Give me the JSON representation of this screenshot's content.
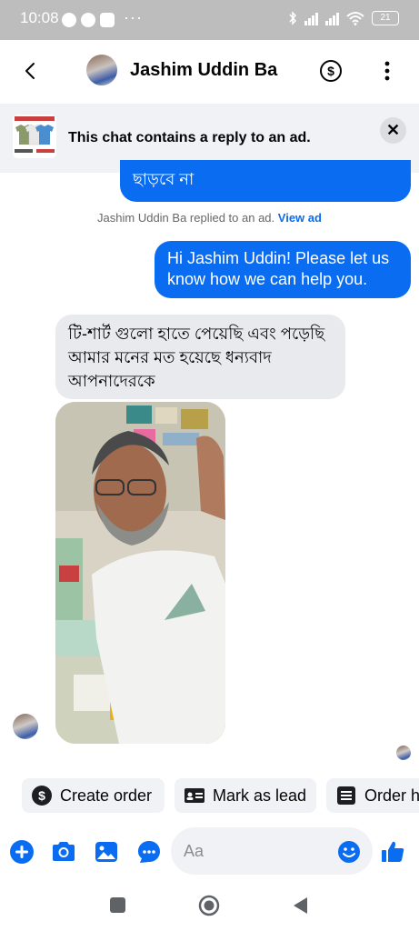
{
  "status_bar": {
    "time": "10:08",
    "overflow": "···",
    "battery": "21"
  },
  "header": {
    "contact_name": "Jashim Uddin Ba",
    "dollar_symbol": "$"
  },
  "banner": {
    "text": "This chat contains a reply to an ad.",
    "close": "✕"
  },
  "messages": {
    "top_partial": "ছাড়বে না",
    "reply_note": "Jashim Uddin Ba replied to an ad.",
    "view_ad": "View ad",
    "outgoing": "Hi Jashim Uddin! Please let us know how we can help you.",
    "incoming": "টি-শার্ট গুলো হাতে পেয়েছি এবং পড়েছি আমার মনের মত হয়েছে ধন্যবাদ আপনাদেরকে"
  },
  "quick_actions": [
    {
      "label": "Create order",
      "icon": "dollar-circle-icon"
    },
    {
      "label": "Mark as lead",
      "icon": "contact-card-icon"
    },
    {
      "label": "Order h",
      "icon": "list-doc-icon"
    }
  ],
  "composer": {
    "placeholder": "Aa"
  },
  "colors": {
    "accent": "#0a6cf0",
    "incoming_bubble": "#e9eaed",
    "banner_bg": "#f0f2f5"
  }
}
